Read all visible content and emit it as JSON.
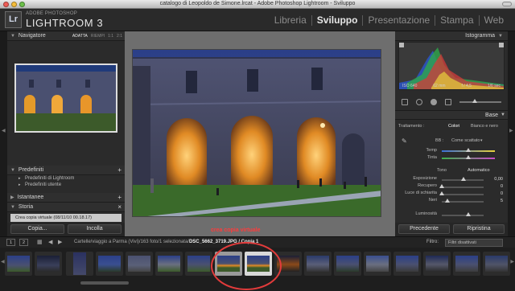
{
  "window": {
    "title": "catalogo di Leopoldo de Simone.lrcat - Adobe Photoshop Lightroom - Sviluppo"
  },
  "brand": {
    "logo": "Lr",
    "small": "ADOBE PHOTOSHOP",
    "big": "LIGHTROOM 3"
  },
  "modules": [
    "Libreria",
    "Sviluppo",
    "Presentazione",
    "Stampa",
    "Web"
  ],
  "active_module": "Sviluppo",
  "left_panel": {
    "navigator_title": "Navigatore",
    "navigator_opts": [
      "ADATTA",
      "RIEMPI",
      "1:1",
      "2:1"
    ],
    "presets_title": "Predefiniti",
    "presets_items": [
      "Predefiniti di Lightroom",
      "Predefiniti utente"
    ],
    "snapshots_title": "Istantanee",
    "history_title": "Storia",
    "history_item": "Crea copia virtuale (08/11/10 00.18.17)",
    "copy_button": "Copia...",
    "paste_button": "Incolla"
  },
  "right_panel": {
    "histogram_title": "Istogramma",
    "histo_iso": "ISO 640",
    "histo_focal": "62 mm",
    "histo_aperture": "f / 4,5",
    "histo_shutter": "1/6 sec",
    "base_title": "Base",
    "treatment_label": "Trattamento :",
    "treatment_color": "Colori",
    "treatment_bw": "Bianco e nero",
    "wb_label": "BB :",
    "wb_value": "Come scattato",
    "temp_label": "Temp",
    "tint_label": "Tinta",
    "tone_label": "Tono",
    "auto_label": "Automatico",
    "sliders": [
      {
        "label": "Esposizione",
        "value": "0,00"
      },
      {
        "label": "Recupero",
        "value": "0"
      },
      {
        "label": "Luce di schiarita",
        "value": "0"
      },
      {
        "label": "Neri",
        "value": "5"
      }
    ],
    "brightness_label": "Luminosità",
    "previous_button": "Precedente",
    "reset_button": "Ripristina"
  },
  "filmstrip_bar": {
    "num1": "1",
    "num2": "2",
    "path_prefix": "Cartelle/viaggio a Parma (Vivi)/163 foto/1 selezionata/",
    "path_file": "DSC_5662_3719.JPG / Copia 1",
    "filter_label": "Filtro:",
    "filter_value": "Filtri disattivati"
  },
  "annotation": "crea copia virtuale",
  "colors": {
    "accent_red": "#e23b3b",
    "panel_bg": "#2b2b2b",
    "main_bg": "#6e6e6e"
  }
}
